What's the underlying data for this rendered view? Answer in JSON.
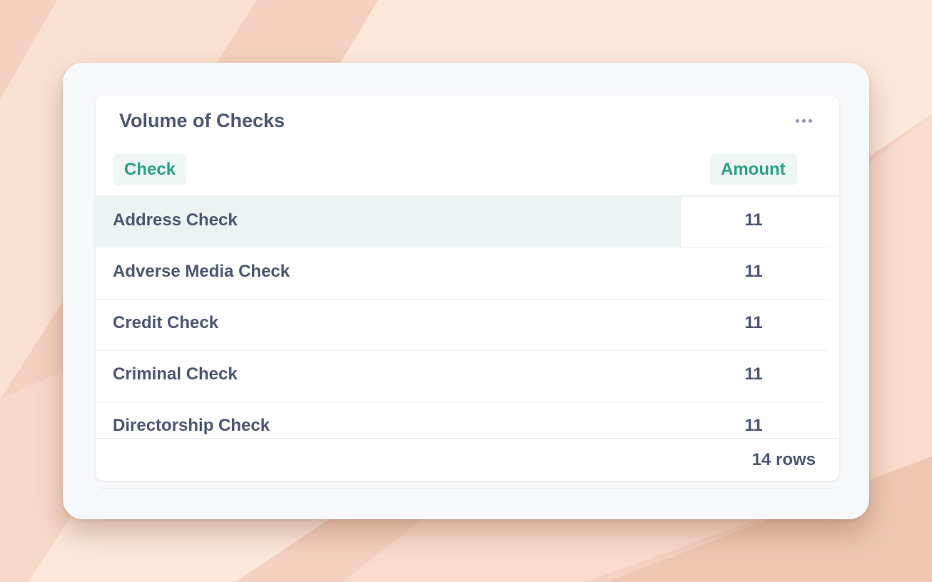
{
  "card": {
    "title": "Volume of Checks",
    "more_icon": "ellipsis-horizontal-icon"
  },
  "table": {
    "columns": [
      "Check",
      "Amount"
    ],
    "rows": [
      {
        "check": "Address Check",
        "amount": "11"
      },
      {
        "check": "Adverse Media Check",
        "amount": "11"
      },
      {
        "check": "Credit Check",
        "amount": "11"
      },
      {
        "check": "Criminal Check",
        "amount": "11"
      },
      {
        "check": "Directorship Check",
        "amount": "11"
      }
    ],
    "row_count": "14 rows"
  },
  "colors": {
    "accent": "#2aa283",
    "accent_bg": "#eef7f4",
    "text": "#4c5773",
    "highlight_row": "#ebf4f2",
    "backdrop": "#f4d2bf"
  }
}
